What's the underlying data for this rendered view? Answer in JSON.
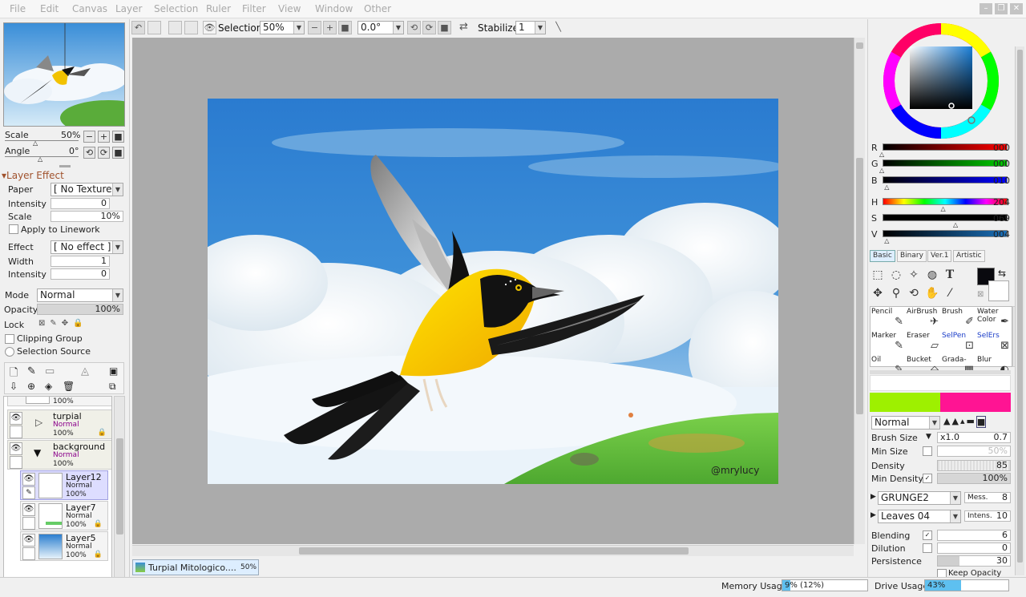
{
  "menu": [
    "File",
    "Edit",
    "Canvas",
    "Layer",
    "Selection",
    "Ruler",
    "Filter",
    "View",
    "Window",
    "Other"
  ],
  "toolbar": {
    "selection_label": "Selection",
    "zoom": "50%",
    "rotation": "0.0°",
    "stabilizer_label": "Stabilizer",
    "stabilizer_value": "1"
  },
  "navigator": {
    "scale_label": "Scale",
    "scale_value": "50%",
    "angle_label": "Angle",
    "angle_value": "0°"
  },
  "layer_effect": {
    "title": "Layer Effect",
    "paper_label": "Paper",
    "paper_value": "[ No Texture ]",
    "intensity_label": "Intensity",
    "intensity_value": "0",
    "scale_label": "Scale",
    "scale_value": "10%",
    "apply_linework": "Apply to Linework",
    "effect_label": "Effect",
    "effect_value": "[ No effect ]",
    "width_label": "Width",
    "width_value": "1",
    "intensity2_label": "Intensity",
    "intensity2_value": "0"
  },
  "layer_props": {
    "mode_label": "Mode",
    "mode_value": "Normal",
    "opacity_label": "Opacity",
    "opacity_value": "100%",
    "lock_label": "Lock",
    "clipping_group": "Clipping Group",
    "selection_source": "Selection Source"
  },
  "layers": [
    {
      "name": "",
      "mode": "",
      "opacity": "100%",
      "type": "partial"
    },
    {
      "name": "turpial",
      "mode": "Normal",
      "opacity": "100%",
      "type": "folder"
    },
    {
      "name": "background",
      "mode": "Normal",
      "opacity": "100%",
      "type": "folder"
    },
    {
      "name": "Layer12",
      "mode": "Normal",
      "opacity": "100%",
      "type": "layer",
      "selected": true
    },
    {
      "name": "Layer7",
      "mode": "Normal",
      "opacity": "100%",
      "type": "layer"
    },
    {
      "name": "Layer5",
      "mode": "Normal",
      "opacity": "100%",
      "type": "layer"
    }
  ],
  "document_tab": {
    "name": "Turpial Mitologico....",
    "zoom": "50%"
  },
  "color": {
    "R": "000",
    "G": "000",
    "B": "010",
    "H": "204",
    "S": "069",
    "V": "004",
    "r_level": 0.0,
    "g_level": 0.0,
    "b_level": 0.04,
    "h_level": 0.49,
    "s_level": 0.59,
    "v_level": 0.04,
    "primary": "#0a0a0f",
    "swatch_a": "#9ef000",
    "swatch_b": "#ff1493"
  },
  "tool_tabs": [
    "Basic",
    "Binary",
    "Ver.1",
    "Artistic"
  ],
  "brushes": [
    {
      "name": "Pencil",
      "color": "normal"
    },
    {
      "name": "AirBrush",
      "color": "normal"
    },
    {
      "name": "Brush",
      "color": "normal"
    },
    {
      "name": "Water Color",
      "color": "normal"
    },
    {
      "name": "Marker",
      "color": "normal"
    },
    {
      "name": "Eraser",
      "color": "normal"
    },
    {
      "name": "SelPen",
      "color": "blue"
    },
    {
      "name": "SelErs",
      "color": "blue"
    },
    {
      "name": "Oil",
      "color": "normal"
    },
    {
      "name": "Bucket",
      "color": "normal"
    },
    {
      "name": "Grada-",
      "color": "normal"
    },
    {
      "name": "Blur",
      "color": "normal"
    }
  ],
  "brush_settings": {
    "blend_mode": "Normal",
    "brush_size_label": "Brush Size",
    "brush_size_mult": "x1.0",
    "brush_size_value": "0.7",
    "min_size_label": "Min Size",
    "min_size_value": "50%",
    "density_label": "Density",
    "density_value": "85",
    "min_density_label": "Min Density",
    "min_density_value": "100%",
    "texture1": "GRUNGE2",
    "texture1_param": "Mess.",
    "texture1_value": "8",
    "texture2": "Leaves 04",
    "texture2_param": "Intens.",
    "texture2_value": "10",
    "blending_label": "Blending",
    "blending_value": "6",
    "dilution_label": "Dilution",
    "dilution_value": "0",
    "persistence_label": "Persistence",
    "persistence_value": "30",
    "keep_opacity": "Keep Opacity"
  },
  "status": {
    "memory_label": "Memory Usage",
    "memory_value": "9% (12%)",
    "memory_level": 0.09,
    "drive_label": "Drive Usage",
    "drive_value": "43%",
    "drive_level": 0.43
  },
  "signature": "@mrylucy"
}
